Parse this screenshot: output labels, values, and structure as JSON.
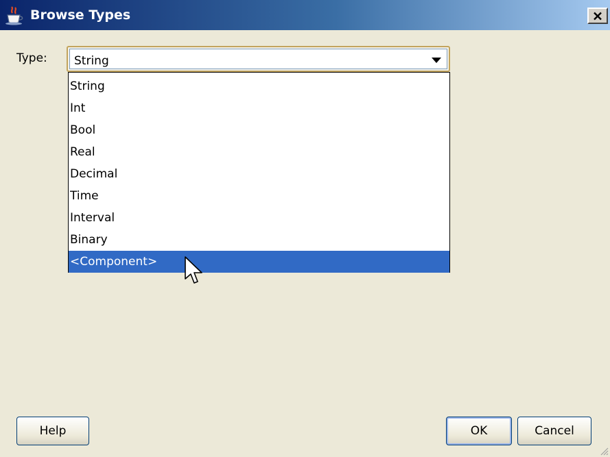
{
  "window": {
    "title": "Browse Types",
    "app_icon": "java-cup-icon",
    "close_icon": "close-icon"
  },
  "form": {
    "type_label": "Type:",
    "type_value": "String",
    "dropdown_arrow_icon": "chevron-down-icon",
    "options": [
      "String",
      "Int",
      "Bool",
      "Real",
      "Decimal",
      "Time",
      "Interval",
      "Binary",
      "<Component>"
    ],
    "highlighted_option": "<Component>"
  },
  "buttons": {
    "help_label": "Help",
    "ok_label": "OK",
    "cancel_label": "Cancel"
  },
  "colors": {
    "selection": "#316ac5",
    "title_gradient_start": "#0a246a",
    "title_gradient_end": "#a6caf0",
    "dialog_background": "#ece9d8"
  }
}
